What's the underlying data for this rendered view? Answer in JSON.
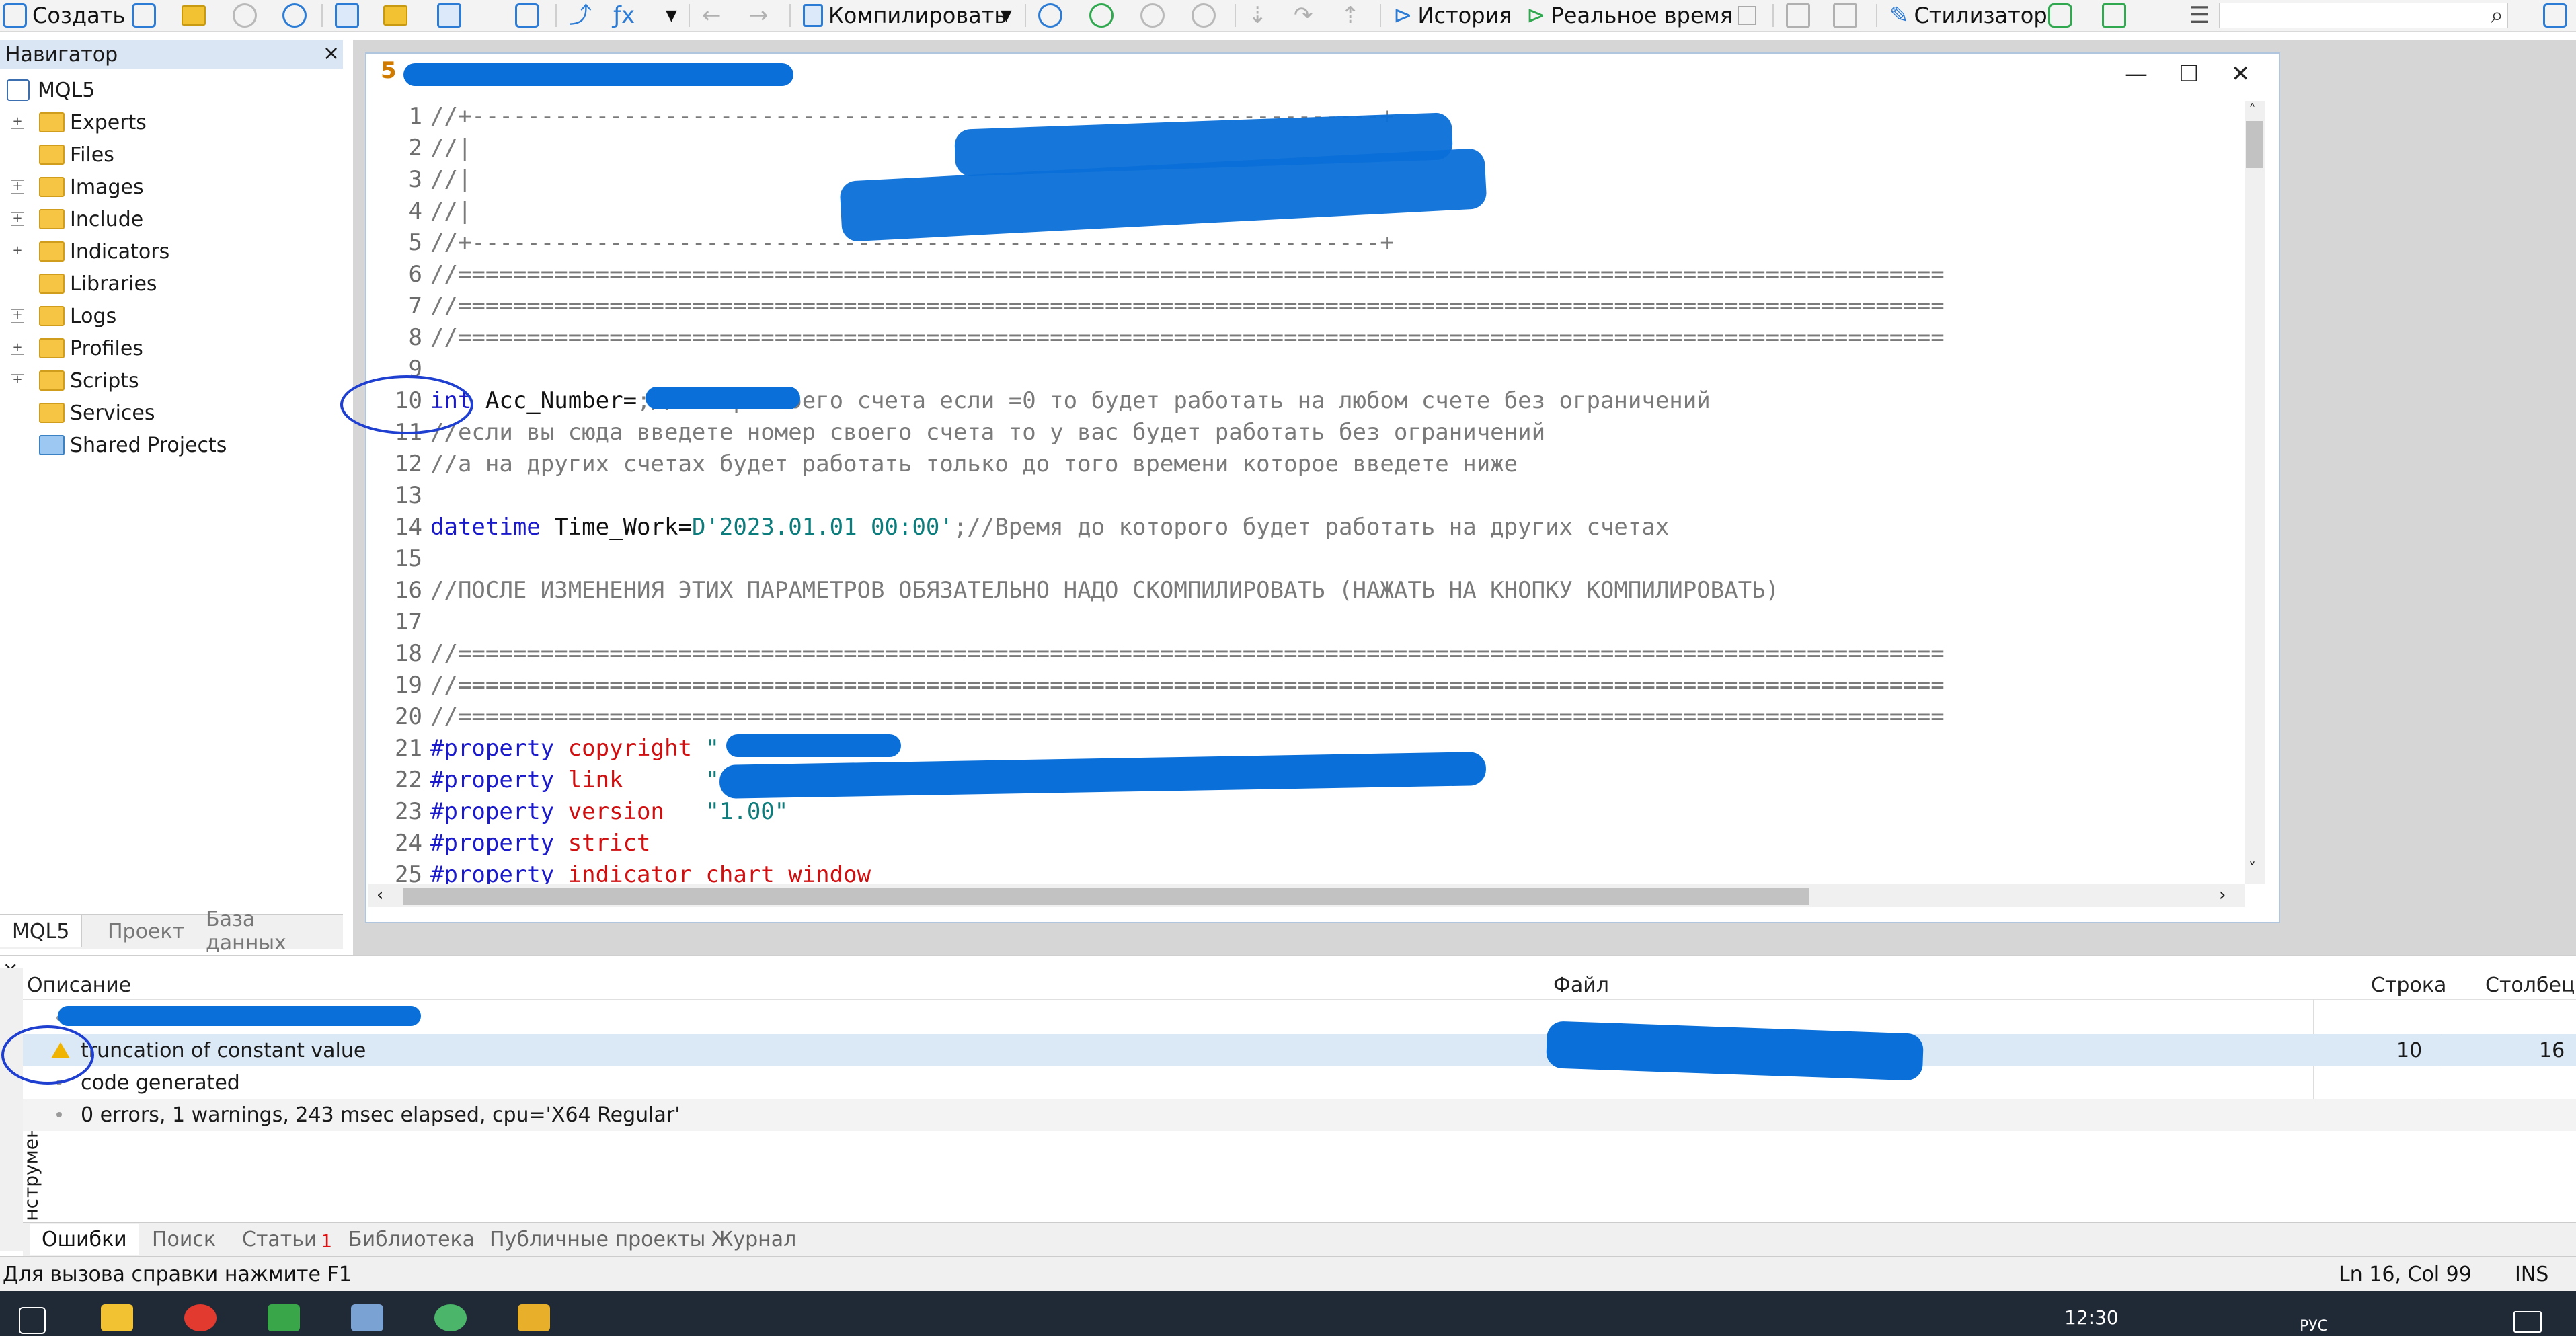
{
  "toolbar": {
    "create_label": "Создать",
    "compile_label": "Компилировать",
    "history_label": "История",
    "realtime_label": "Реальное время",
    "styler_label": "Стилизатор"
  },
  "navigator": {
    "title": "Навигатор",
    "root": "MQL5",
    "items": [
      {
        "label": "Experts",
        "expandable": true
      },
      {
        "label": "Files",
        "expandable": false
      },
      {
        "label": "Images",
        "expandable": true
      },
      {
        "label": "Include",
        "expandable": true
      },
      {
        "label": "Indicators",
        "expandable": true
      },
      {
        "label": "Libraries",
        "expandable": false
      },
      {
        "label": "Logs",
        "expandable": true
      },
      {
        "label": "Profiles",
        "expandable": true
      },
      {
        "label": "Scripts",
        "expandable": true
      },
      {
        "label": "Services",
        "expandable": false
      },
      {
        "label": "Shared Projects",
        "expandable": false
      }
    ],
    "tabs": [
      "MQL5",
      "Проект",
      "База данных"
    ]
  },
  "editor": {
    "window_number": "5",
    "lines": [
      {
        "n": "1",
        "text": "//+------------------------------------------------------------------+"
      },
      {
        "n": "2",
        "text": "//|"
      },
      {
        "n": "3",
        "text": "//|"
      },
      {
        "n": "4",
        "text": "//|"
      },
      {
        "n": "5",
        "text": "//+------------------------------------------------------------------+"
      },
      {
        "n": "6",
        "text": "//============================================================================================================"
      },
      {
        "n": "7",
        "text": "//============================================================================================================"
      },
      {
        "n": "8",
        "text": "//============================================================================================================"
      },
      {
        "n": "9",
        "text": ""
      },
      {
        "n": "10",
        "kw": "int",
        "id": " Acc_Number=",
        "com": ";//Номер своего счета если =0 то будет работать на любом счете без ограничений"
      },
      {
        "n": "11",
        "text": "//если вы сюда введете номер своего счета то у вас будет работать без ограничений"
      },
      {
        "n": "12",
        "text": "//а на других счетах будет работать только до того времени которое введете ниже"
      },
      {
        "n": "13",
        "text": ""
      },
      {
        "n": "14",
        "kw": "datetime",
        "id": " Time_Work=",
        "str": "D'2023.01.01 00:00'",
        "com": ";//Время до которого будет работать на других счетах"
      },
      {
        "n": "15",
        "text": ""
      },
      {
        "n": "16",
        "text": "//ПОСЛЕ ИЗМЕНЕНИЯ ЭТИХ ПАРАМЕТРОВ ОБЯЗАТЕЛЬНО НАДО СКОМПИЛИРОВАТЬ (НАЖАТЬ НА КНОПКУ КОМПИЛИРОВАТЬ)"
      },
      {
        "n": "17",
        "text": ""
      },
      {
        "n": "18",
        "text": "//============================================================================================================"
      },
      {
        "n": "19",
        "text": "//============================================================================================================"
      },
      {
        "n": "20",
        "text": "//============================================================================================================"
      },
      {
        "n": "21",
        "prop": "#property",
        "key": " copyright",
        "str": " \""
      },
      {
        "n": "22",
        "prop": "#property",
        "key": " link",
        "str": "      \""
      },
      {
        "n": "23",
        "prop": "#property",
        "key": " version",
        "str": "   \"1.00\""
      },
      {
        "n": "24",
        "prop": "#property",
        "key": " strict"
      },
      {
        "n": "25",
        "prop": "#property",
        "key": " indicator_chart_window"
      }
    ]
  },
  "output": {
    "columns": {
      "description": "Описание",
      "file": "Файл",
      "line": "Строка",
      "column": "Столбец"
    },
    "rows": [
      {
        "type": "info",
        "text": "",
        "line": "",
        "col": ""
      },
      {
        "type": "warning",
        "text": "truncation of constant value",
        "line": "10",
        "col": "16"
      },
      {
        "type": "info",
        "text": "code generated",
        "line": "",
        "col": ""
      },
      {
        "type": "info",
        "text": "0 errors, 1 warnings, 243 msec elapsed, cpu='X64 Regular'",
        "line": "",
        "col": ""
      }
    ],
    "side_label": "Инструменты",
    "tabs": [
      "Ошибки",
      "Поиск",
      "Статьи",
      "Библиотека",
      "Публичные проекты",
      "Журнал"
    ],
    "articles_badge": "1"
  },
  "status": {
    "help": "Для вызова справки нажмите F1",
    "position": "Ln 16, Col 99",
    "mode": "INS"
  },
  "taskbar": {
    "time": "12:30",
    "lang": "РУС"
  }
}
